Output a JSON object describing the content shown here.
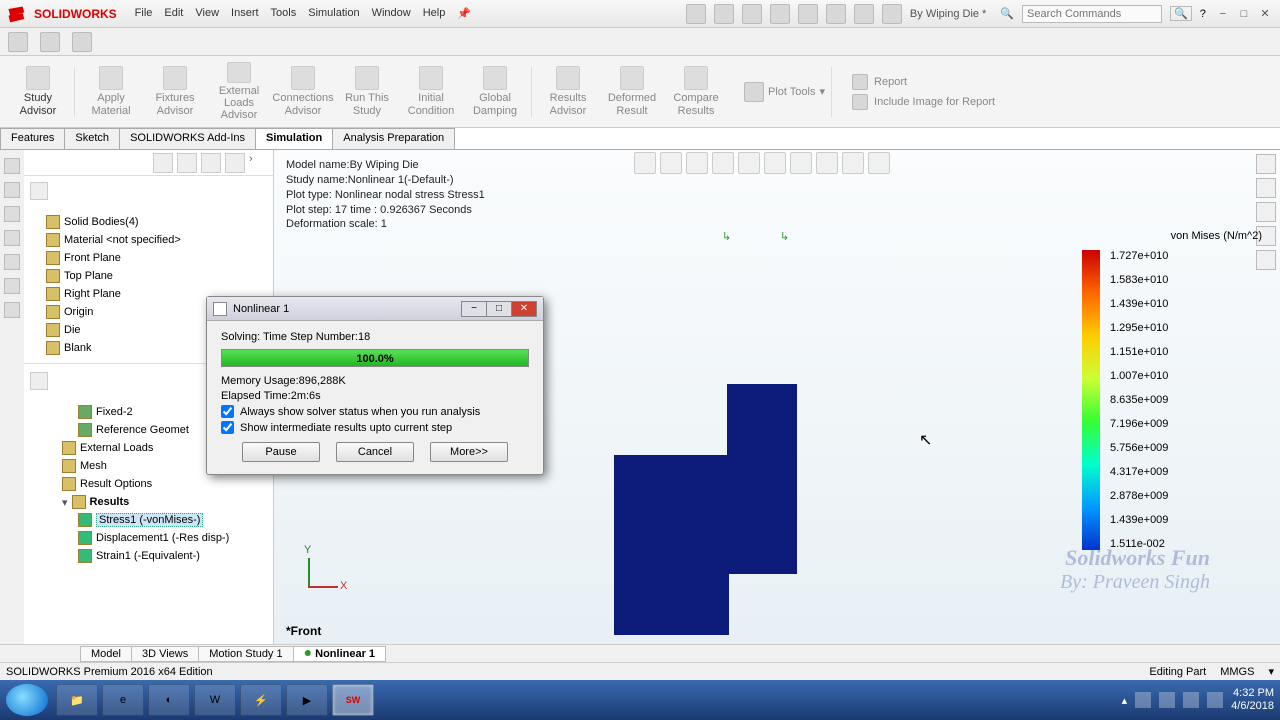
{
  "app": {
    "name": "SOLIDWORKS",
    "document_title": "By Wiping Die *"
  },
  "menu": [
    "File",
    "Edit",
    "View",
    "Insert",
    "Tools",
    "Simulation",
    "Window",
    "Help"
  ],
  "search_placeholder": "Search Commands",
  "ribbon": {
    "buttons": [
      {
        "label": "Study\nAdvisor",
        "active": true
      },
      {
        "label": "Apply\nMaterial"
      },
      {
        "label": "Fixtures\nAdvisor"
      },
      {
        "label": "External Loads\nAdvisor"
      },
      {
        "label": "Connections\nAdvisor"
      },
      {
        "label": "Run This\nStudy"
      },
      {
        "label": "Initial\nCondition"
      },
      {
        "label": "Global\nDamping"
      },
      {
        "label": "Results\nAdvisor"
      },
      {
        "label": "Deformed\nResult"
      },
      {
        "label": "Compare\nResults"
      }
    ],
    "plot_tools": "Plot Tools",
    "right": [
      "Report",
      "Include Image for Report"
    ]
  },
  "feature_tabs": [
    "Features",
    "Sketch",
    "SOLIDWORKS Add-Ins",
    "Simulation",
    "Analysis Preparation"
  ],
  "feature_tab_active": 3,
  "tree": {
    "top": [
      {
        "label": "Solid Bodies(4)"
      },
      {
        "label": "Material <not specified>"
      },
      {
        "label": "Front Plane"
      },
      {
        "label": "Top Plane"
      },
      {
        "label": "Right Plane"
      },
      {
        "label": "Origin"
      },
      {
        "label": "Die"
      },
      {
        "label": "Blank"
      }
    ],
    "bottom": [
      {
        "label": "Fixed-2",
        "indent": 2
      },
      {
        "label": "Reference Geomet",
        "indent": 2
      },
      {
        "label": "External Loads",
        "indent": 1
      },
      {
        "label": "Mesh",
        "indent": 1
      },
      {
        "label": "Result Options",
        "indent": 1
      },
      {
        "label": "Results",
        "indent": 1,
        "expanded": true
      },
      {
        "label": "Stress1 (-vonMises-)",
        "indent": 2,
        "selected": true
      },
      {
        "label": "Displacement1 (-Res disp-)",
        "indent": 2
      },
      {
        "label": "Strain1 (-Equivalent-)",
        "indent": 2
      }
    ]
  },
  "model_info": [
    "Model name:By Wiping Die",
    "Study name:Nonlinear 1(-Default-)",
    "Plot type: Nonlinear nodal stress Stress1",
    "Plot step: 17   time : 0.926367 Seconds",
    "Deformation scale: 1"
  ],
  "legend": {
    "title": "von Mises (N/m^2)",
    "values": [
      "1.727e+010",
      "1.583e+010",
      "1.439e+010",
      "1.295e+010",
      "1.151e+010",
      "1.007e+010",
      "8.635e+009",
      "7.196e+009",
      "5.756e+009",
      "4.317e+009",
      "2.878e+009",
      "1.439e+009",
      "1.511e-002"
    ]
  },
  "dialog": {
    "title": "Nonlinear 1",
    "status_prefix": "Solving:   Time Step Number:",
    "status_value": "18",
    "progress_text": "100.0%",
    "memory_label": "Memory Usage:",
    "memory_value": "896,288K",
    "elapsed_label": "Elapsed Time:",
    "elapsed_value": "2m:6s",
    "check1": "Always show solver status when you run analysis",
    "check2": "Show intermediate results upto current step",
    "btn_pause": "Pause",
    "btn_cancel": "Cancel",
    "btn_more": "More>>"
  },
  "view_label": "*Front",
  "triad": {
    "y": "Y",
    "x": "X"
  },
  "bottom_tabs": [
    {
      "label": "Model"
    },
    {
      "label": "3D Views"
    },
    {
      "label": "Motion Study 1"
    },
    {
      "label": "Nonlinear 1",
      "active": true
    }
  ],
  "statusbar": {
    "left": "SOLIDWORKS Premium 2016 x64 Edition",
    "center": "Editing Part",
    "right": "MMGS"
  },
  "watermark": {
    "line1": "Solidworks Fun",
    "line2": "By: Praveen Singh"
  },
  "clock": {
    "time": "4:32 PM",
    "date": "4/6/2018"
  }
}
